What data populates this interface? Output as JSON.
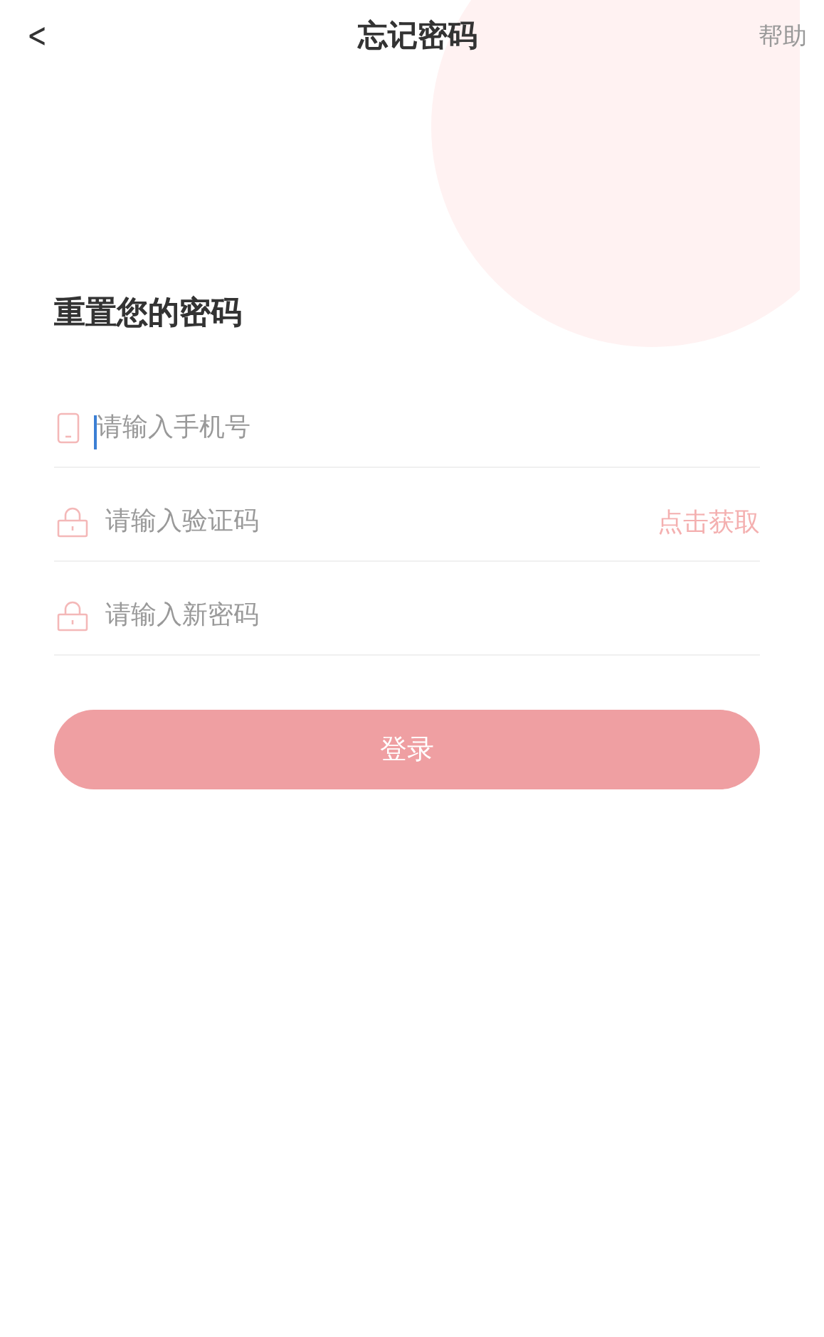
{
  "header": {
    "back": "<",
    "title": "忘记密码",
    "help": "帮助"
  },
  "heading": "重置您的密码",
  "fields": [
    {
      "kind": "phone",
      "placeholder": "请输入手机号",
      "focused": true
    },
    {
      "kind": "lock",
      "placeholder": "请输入验证码",
      "action": "点击获取",
      "focused": false
    },
    {
      "kind": "lock",
      "placeholder": "请输入新密码",
      "focused": false
    }
  ],
  "submit": {
    "label": "登录",
    "disabled": true
  }
}
